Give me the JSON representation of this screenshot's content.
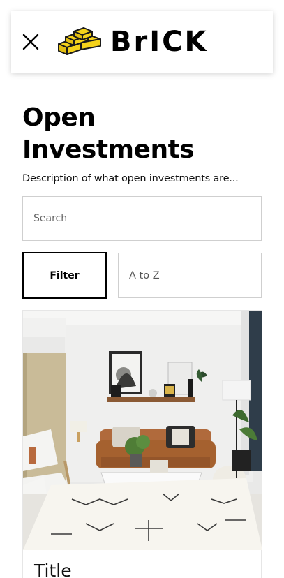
{
  "header": {
    "brand": "BrICK"
  },
  "main": {
    "title": "Open Investments",
    "description": "Description of what open investments are...",
    "search": {
      "placeholder": "Search",
      "value": ""
    },
    "filter_label": "Filter",
    "sort": {
      "selected": "A to Z"
    },
    "cards": [
      {
        "title": "Title",
        "image": "living-room-photo"
      }
    ]
  },
  "colors": {
    "brick_yellow": "#F5D21B",
    "brick_outline": "#1a1a1a",
    "border": "#cfcfcf"
  }
}
